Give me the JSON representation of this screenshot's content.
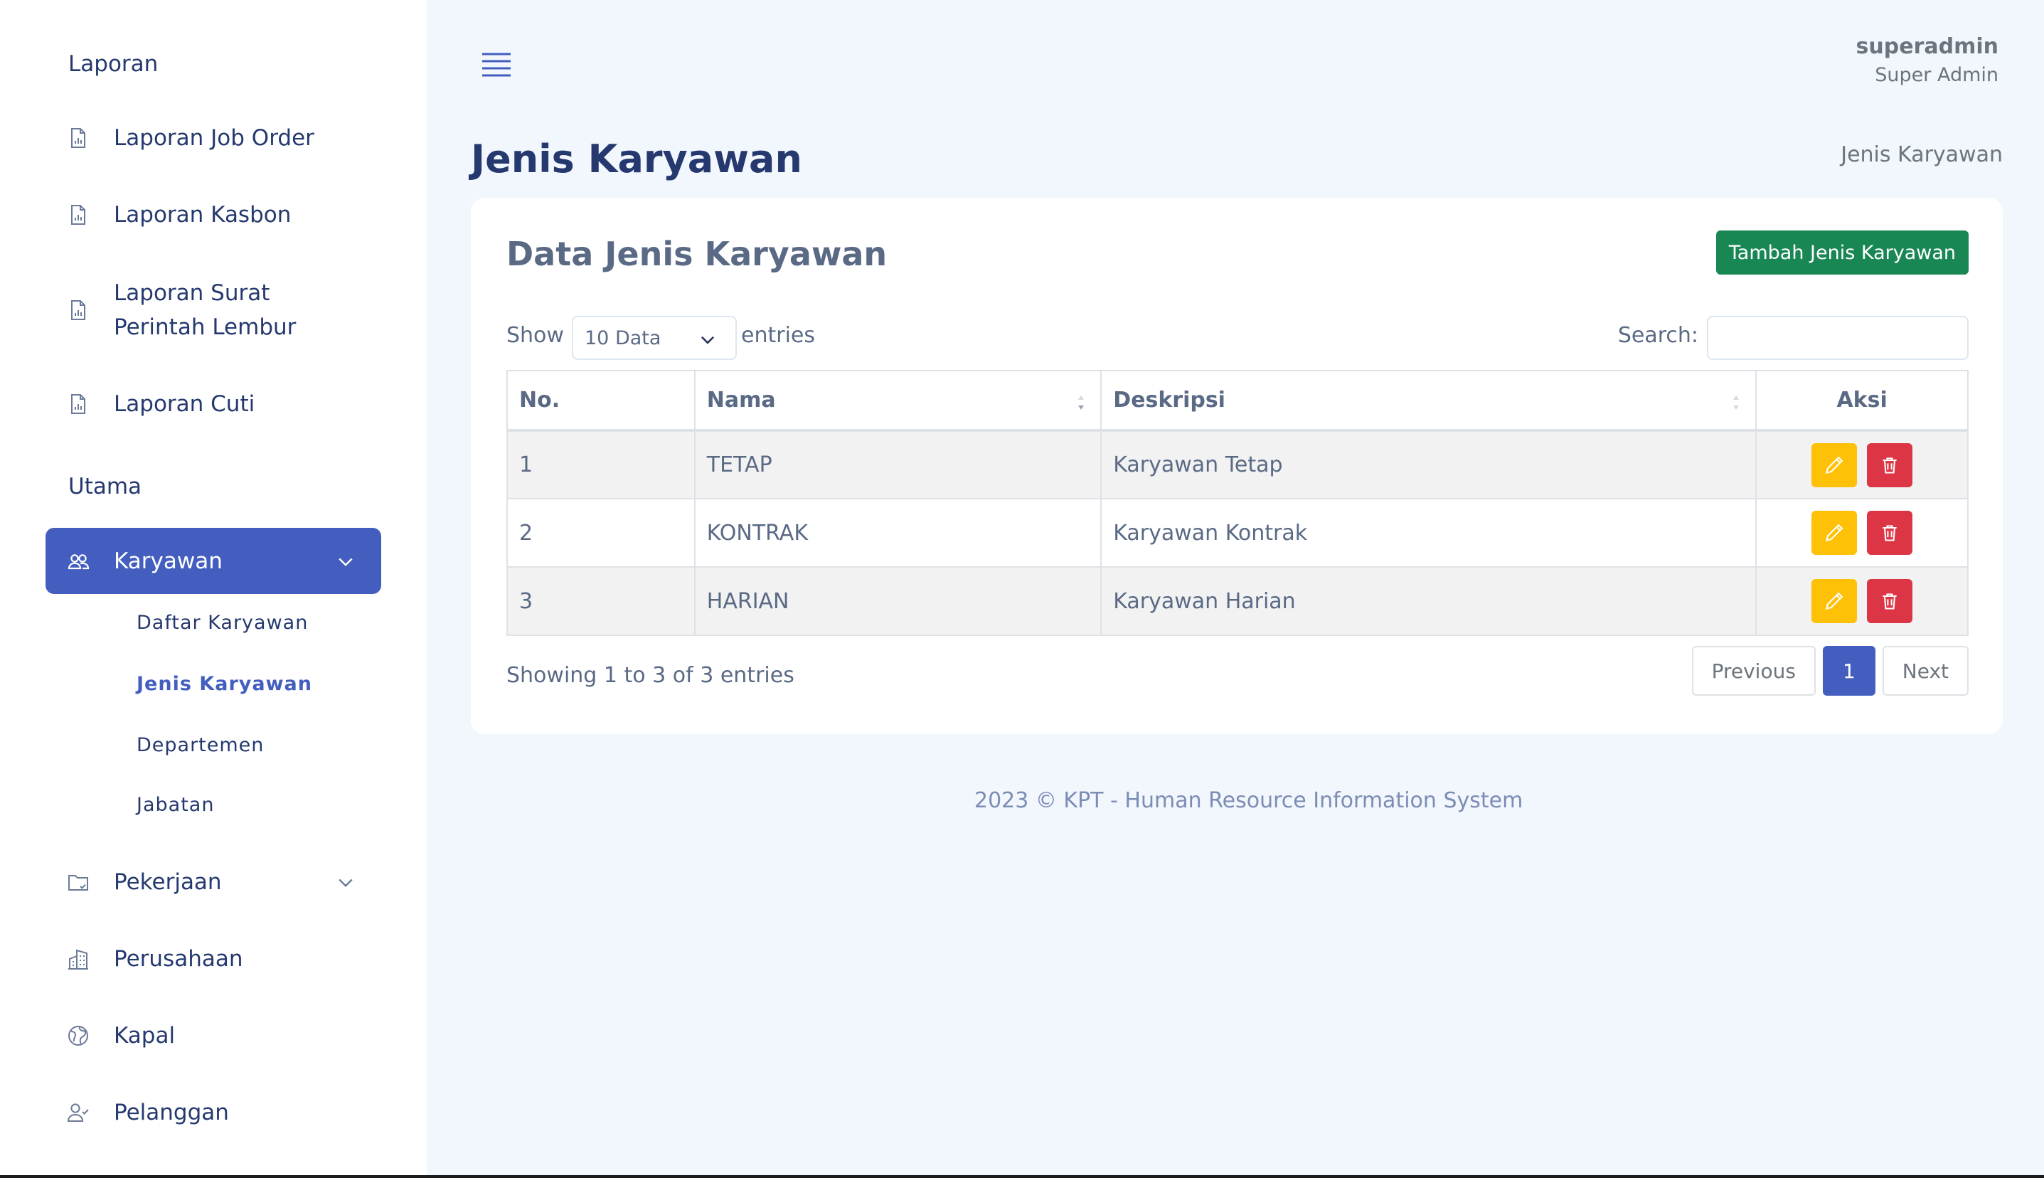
{
  "sidebar": {
    "section_laporan": "Laporan",
    "laporan_items": [
      {
        "label": "Laporan Job Order",
        "icon": "report-icon"
      },
      {
        "label": "Laporan Kasbon",
        "icon": "report-icon"
      },
      {
        "label": "Laporan Surat Perintah Lembur",
        "icon": "report-icon"
      },
      {
        "label": "Laporan Cuti",
        "icon": "report-icon"
      }
    ],
    "section_utama": "Utama",
    "karyawan": {
      "label": "Karyawan",
      "icon": "people-icon"
    },
    "karyawan_sub": [
      "Daftar Karyawan",
      "Jenis Karyawan",
      "Departemen",
      "Jabatan"
    ],
    "pekerjaan": {
      "label": "Pekerjaan",
      "icon": "folder-icon"
    },
    "perusahaan": {
      "label": "Perusahaan",
      "icon": "building-icon"
    },
    "kapal": {
      "label": "Kapal",
      "icon": "globe-icon"
    },
    "pelanggan": {
      "label": "Pelanggan",
      "icon": "person-check-icon"
    }
  },
  "header": {
    "user_name": "superadmin",
    "user_role": "Super Admin"
  },
  "page": {
    "title": "Jenis Karyawan",
    "breadcrumb": "Jenis Karyawan"
  },
  "card": {
    "title": "Data Jenis Karyawan",
    "add_button": "Tambah Jenis Karyawan",
    "show_label": "Show",
    "entries_selected": "10 Data",
    "entries_label": "entries",
    "search_label": "Search:",
    "search_value": ""
  },
  "table": {
    "headers": {
      "no": "No.",
      "nama": "Nama",
      "deskripsi": "Deskripsi",
      "aksi": "Aksi"
    },
    "rows": [
      {
        "no": "1",
        "nama": "TETAP",
        "deskripsi": "Karyawan Tetap"
      },
      {
        "no": "2",
        "nama": "KONTRAK",
        "deskripsi": "Karyawan Kontrak"
      },
      {
        "no": "3",
        "nama": "HARIAN",
        "deskripsi": "Karyawan Harian"
      }
    ]
  },
  "pagination": {
    "info": "Showing 1 to 3 of 3 entries",
    "previous": "Previous",
    "current": "1",
    "next": "Next"
  },
  "footer": "2023 © KPT - Human Resource Information System",
  "colors": {
    "primary": "#435ebe",
    "success": "#198754",
    "warning": "#ffc107",
    "danger": "#dc3545",
    "background": "#f2f6fd"
  }
}
